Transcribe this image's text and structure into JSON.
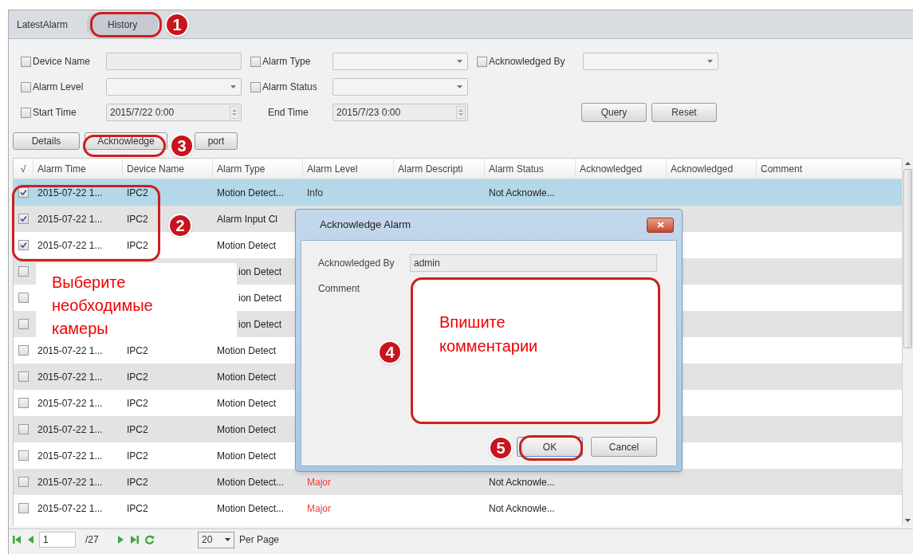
{
  "tabs": [
    {
      "label": "LatestAlarm",
      "selected": false
    },
    {
      "label": "History",
      "selected": true
    }
  ],
  "filters": [
    [
      {
        "label": "Device Name",
        "checked": false,
        "kind": "text"
      },
      {
        "label": "Alarm Type",
        "checked": false,
        "kind": "select"
      },
      {
        "label": "Acknowledged By",
        "checked": false,
        "kind": "select"
      }
    ],
    [
      {
        "label": "Alarm Level",
        "checked": false,
        "kind": "select"
      },
      {
        "label": "Alarm Status",
        "checked": false,
        "kind": "select"
      }
    ],
    [
      {
        "label": "Start Time",
        "checked": false,
        "kind": "spin",
        "value": "2015/7/22 0:00"
      },
      {
        "label": "End Time",
        "kind": "spin",
        "value": "2015/7/23 0:00"
      }
    ]
  ],
  "filter_buttons": [
    "Query",
    "Reset"
  ],
  "toolbar": [
    "Details",
    "Acknowledge",
    "port"
  ],
  "table": {
    "columns": [
      "√",
      "Alarm Time",
      "Device Name",
      "Alarm Type",
      "Alarm Level",
      "Alarm Descripti",
      "Alarm Status",
      "Acknowledged",
      "Acknowledged",
      "Comment"
    ],
    "rows": [
      {
        "checked": true,
        "selected": true,
        "time": "2015-07-22 1...",
        "device": "IPC2",
        "type": "Motion Detect...",
        "level": {
          "text": "Info",
          "color": "#333333"
        },
        "status": "Not Acknowle..."
      },
      {
        "checked": true,
        "selected": false,
        "time": "2015-07-22 1...",
        "device": "IPC2",
        "type": "Alarm Input Cl"
      },
      {
        "checked": true,
        "selected": false,
        "time": "2015-07-22 1...",
        "device": "IPC2",
        "type": "Motion Detect"
      },
      {
        "checked": false,
        "selected": false,
        "type": "ion Detect"
      },
      {
        "checked": false,
        "selected": false,
        "type": "ion Detect"
      },
      {
        "checked": false,
        "selected": false,
        "type": "ion Detect"
      },
      {
        "checked": false,
        "selected": false,
        "time": "2015-07-22 1...",
        "device": "IPC2",
        "type": "Motion Detect"
      },
      {
        "checked": false,
        "selected": false,
        "time": "2015-07-22 1...",
        "device": "IPC2",
        "type": "Motion Detect"
      },
      {
        "checked": false,
        "selected": false,
        "time": "2015-07-22 1...",
        "device": "IPC2",
        "type": "Motion Detect"
      },
      {
        "checked": false,
        "selected": false,
        "time": "2015-07-22 1...",
        "device": "IPC2",
        "type": "Motion Detect"
      },
      {
        "checked": false,
        "selected": false,
        "time": "2015-07-22 1...",
        "device": "IPC2",
        "type": "Motion Detect"
      },
      {
        "checked": false,
        "selected": false,
        "time": "2015-07-22 1...",
        "device": "IPC2",
        "type": "Motion Detect...",
        "level": {
          "text": "Major",
          "color": "#e8413c"
        },
        "status": "Not Acknowle..."
      },
      {
        "checked": false,
        "selected": false,
        "time": "2015-07-22 1...",
        "device": "IPC2",
        "type": "Motion Detect...",
        "level": {
          "text": "Major",
          "color": "#e8413c"
        },
        "status": "Not Acknowle..."
      }
    ]
  },
  "pagination": {
    "page": "1",
    "total": "/27",
    "per_page": "20",
    "per_page_label": "Per Page"
  },
  "dialog": {
    "title": "Acknowledge Alarm",
    "ack_label": "Acknowledged By",
    "ack_value": "admin",
    "comment_label": "Comment",
    "buttons": [
      "OK",
      "Cancel"
    ]
  },
  "annotations": {
    "badges": [
      "1",
      "3",
      "2",
      "4",
      "5"
    ],
    "callouts": [
      "Выберите необходимые камеры",
      "Впишите комментарии"
    ]
  }
}
